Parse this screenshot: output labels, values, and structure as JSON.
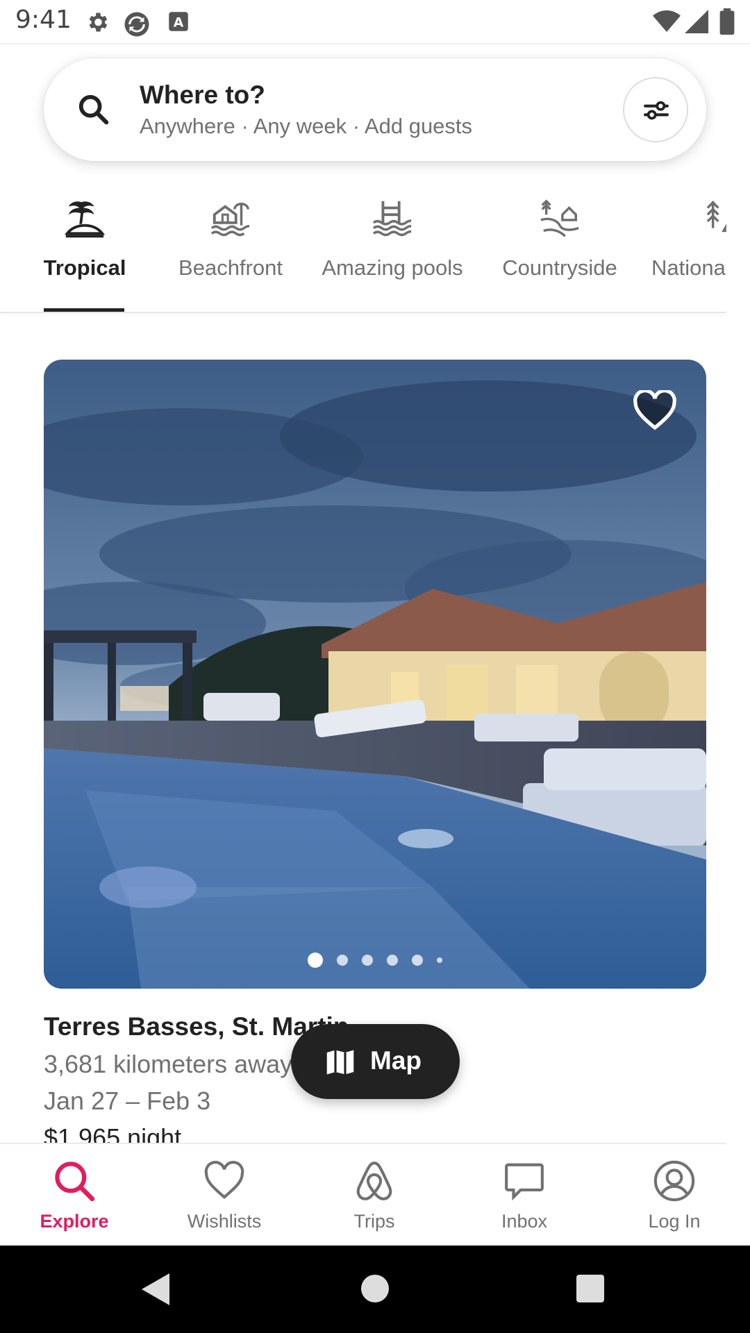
{
  "status_bar": {
    "time": "9:41",
    "icons": [
      "settings-icon",
      "sync-icon",
      "keyboard-a-icon",
      "wifi-icon",
      "signal-icon",
      "battery-icon"
    ]
  },
  "search": {
    "title": "Where to?",
    "subtitle": "Anywhere · Any week · Add guests",
    "icon": "search-icon",
    "filter_icon": "filter-sliders-icon"
  },
  "categories": [
    {
      "label": "Tropical",
      "icon": "palm-tree-icon",
      "active": true
    },
    {
      "label": "Beachfront",
      "icon": "beach-house-icon",
      "active": false
    },
    {
      "label": "Amazing pools",
      "icon": "pool-icon",
      "active": false
    },
    {
      "label": "Countryside",
      "icon": "countryside-icon",
      "active": false
    },
    {
      "label": "Nationa",
      "icon": "national-park-icon",
      "active": false
    }
  ],
  "listing": {
    "title": "Terres Basses, St. Martin",
    "distance": "3,681 kilometers away",
    "dates": "Jan 27 – Feb 3",
    "price": "$1,965 night",
    "photo_dots": 6,
    "active_dot": 1
  },
  "map_button": {
    "label": "Map",
    "icon": "map-icon"
  },
  "bottom_nav": [
    {
      "label": "Explore",
      "icon": "search-icon",
      "active": true
    },
    {
      "label": "Wishlists",
      "icon": "heart-icon",
      "active": false
    },
    {
      "label": "Trips",
      "icon": "airbnb-logo-icon",
      "active": false
    },
    {
      "label": "Inbox",
      "icon": "message-icon",
      "active": false
    },
    {
      "label": "Log In",
      "icon": "user-circle-icon",
      "active": false
    }
  ],
  "colors": {
    "accent": "#e31c5f",
    "text_primary": "#222222",
    "text_secondary": "#717171",
    "map_button_bg": "#222222"
  }
}
